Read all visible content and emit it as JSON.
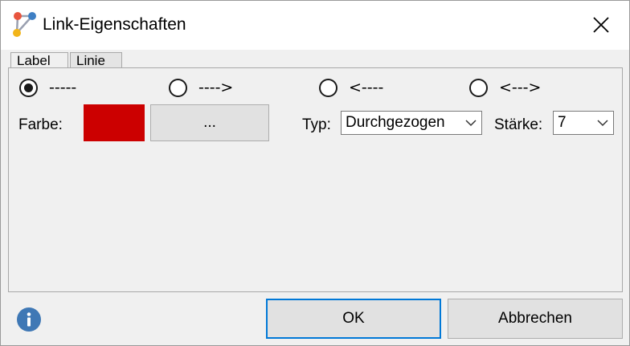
{
  "window": {
    "title": "Link-Eigenschaften"
  },
  "tabs": [
    {
      "label": "Label"
    },
    {
      "label": "Linie"
    }
  ],
  "direction": {
    "options": [
      {
        "label": "-----",
        "selected": true
      },
      {
        "label": "---->",
        "selected": false
      },
      {
        "label": "<----",
        "selected": false
      },
      {
        "label": "<--->",
        "selected": false
      }
    ]
  },
  "color": {
    "label": "Farbe:",
    "value": "#cc0000",
    "picker_label": "..."
  },
  "type": {
    "label": "Typ:",
    "value": "Durchgezogen"
  },
  "strength": {
    "label": "Stärke:",
    "value": "7"
  },
  "footer": {
    "ok_label": "OK",
    "cancel_label": "Abbrechen"
  },
  "colors": {
    "accent": "#0078d7",
    "info": "#3f78b5"
  },
  "icons": {
    "app": "graph-link-icon",
    "close": "close-icon",
    "info": "info-icon"
  }
}
